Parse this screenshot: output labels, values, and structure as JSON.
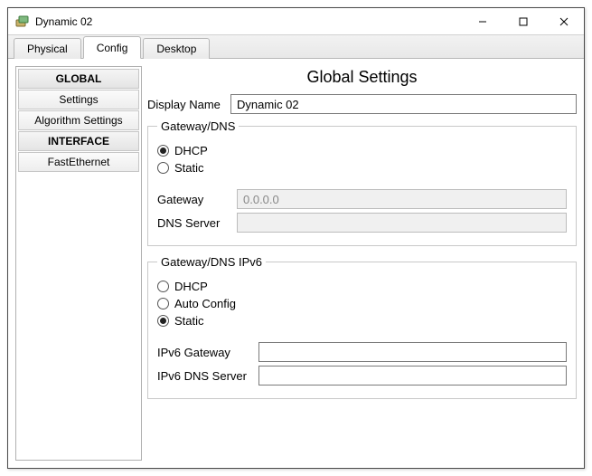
{
  "window": {
    "title": "Dynamic 02"
  },
  "tabs": {
    "physical": "Physical",
    "config": "Config",
    "desktop": "Desktop"
  },
  "sidebar": {
    "global_header": "GLOBAL",
    "settings": "Settings",
    "algorithm_settings": "Algorithm Settings",
    "interface_header": "INTERFACE",
    "fastethernet": "FastEthernet"
  },
  "main": {
    "title": "Global Settings",
    "display_name_label": "Display Name",
    "display_name_value": "Dynamic 02",
    "gw4": {
      "legend": "Gateway/DNS",
      "dhcp": "DHCP",
      "static": "Static",
      "gateway_label": "Gateway",
      "gateway_value": "0.0.0.0",
      "dns_label": "DNS Server",
      "dns_value": ""
    },
    "gw6": {
      "legend": "Gateway/DNS IPv6",
      "dhcp": "DHCP",
      "auto": "Auto Config",
      "static": "Static",
      "gateway_label": "IPv6 Gateway",
      "gateway_value": "",
      "dns_label": "IPv6 DNS Server",
      "dns_value": ""
    }
  }
}
